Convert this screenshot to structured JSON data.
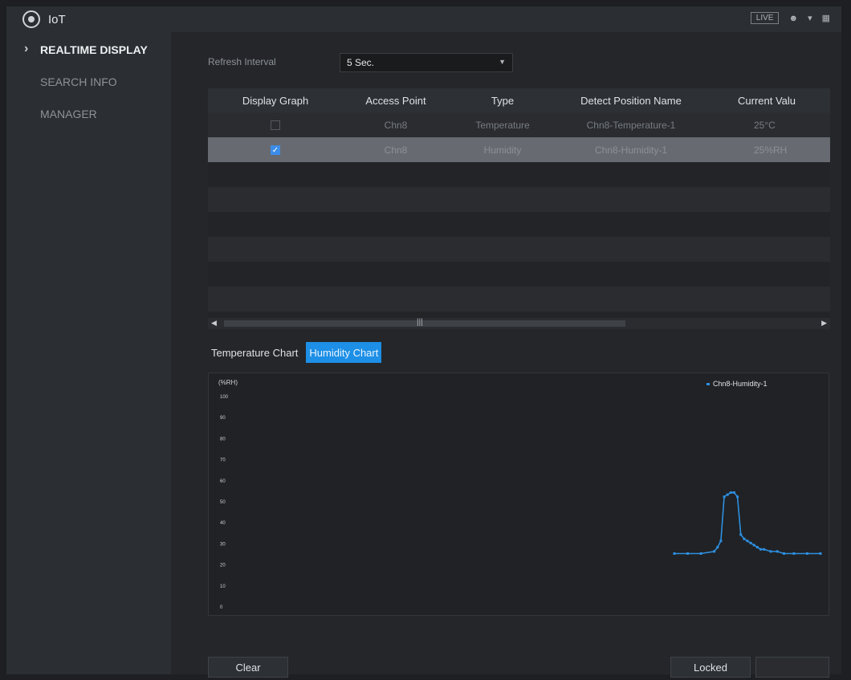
{
  "app": {
    "title": "IoT",
    "live_label": "LIVE"
  },
  "sidebar": {
    "items": [
      {
        "label": "REALTIME DISPLAY"
      },
      {
        "label": "SEARCH INFO"
      },
      {
        "label": "MANAGER"
      }
    ]
  },
  "refresh": {
    "label": "Refresh Interval",
    "value": "5 Sec."
  },
  "table": {
    "columns": [
      "Display Graph",
      "Access Point",
      "Type",
      "Detect Position Name",
      "Current Valu"
    ],
    "rows": [
      {
        "checked": false,
        "access_point": "Chn8",
        "type": "Temperature",
        "position": "Chn8-Temperature-1",
        "value": "25°C"
      },
      {
        "checked": true,
        "access_point": "Chn8",
        "type": "Humidity",
        "position": "Chn8-Humidity-1",
        "value": "25%RH"
      }
    ]
  },
  "tabs": [
    "Temperature Chart",
    "Humidity Chart"
  ],
  "chart_data": {
    "type": "line",
    "ylabel": "(%RH)",
    "ylim": [
      0,
      100
    ],
    "y_ticks": [
      "100",
      "90",
      "80",
      "70",
      "60",
      "50",
      "40",
      "30",
      "20",
      "10",
      "0"
    ],
    "series": [
      {
        "name": "Chn8-Humidity-1",
        "color": "#2e8fe0",
        "x": [
          0,
          4,
          8,
          12,
          13,
          14,
          15,
          16,
          17,
          18,
          19,
          20,
          21,
          22,
          23,
          24,
          25,
          26,
          27,
          29,
          31,
          33,
          36,
          40,
          44
        ],
        "values": [
          25,
          25,
          25,
          26,
          28,
          31,
          52,
          53,
          54,
          54,
          52,
          34,
          32,
          31,
          30,
          29,
          28,
          27,
          27,
          26,
          26,
          25,
          25,
          25,
          25
        ]
      }
    ]
  },
  "buttons": {
    "clear": "Clear",
    "locked": "Locked"
  }
}
